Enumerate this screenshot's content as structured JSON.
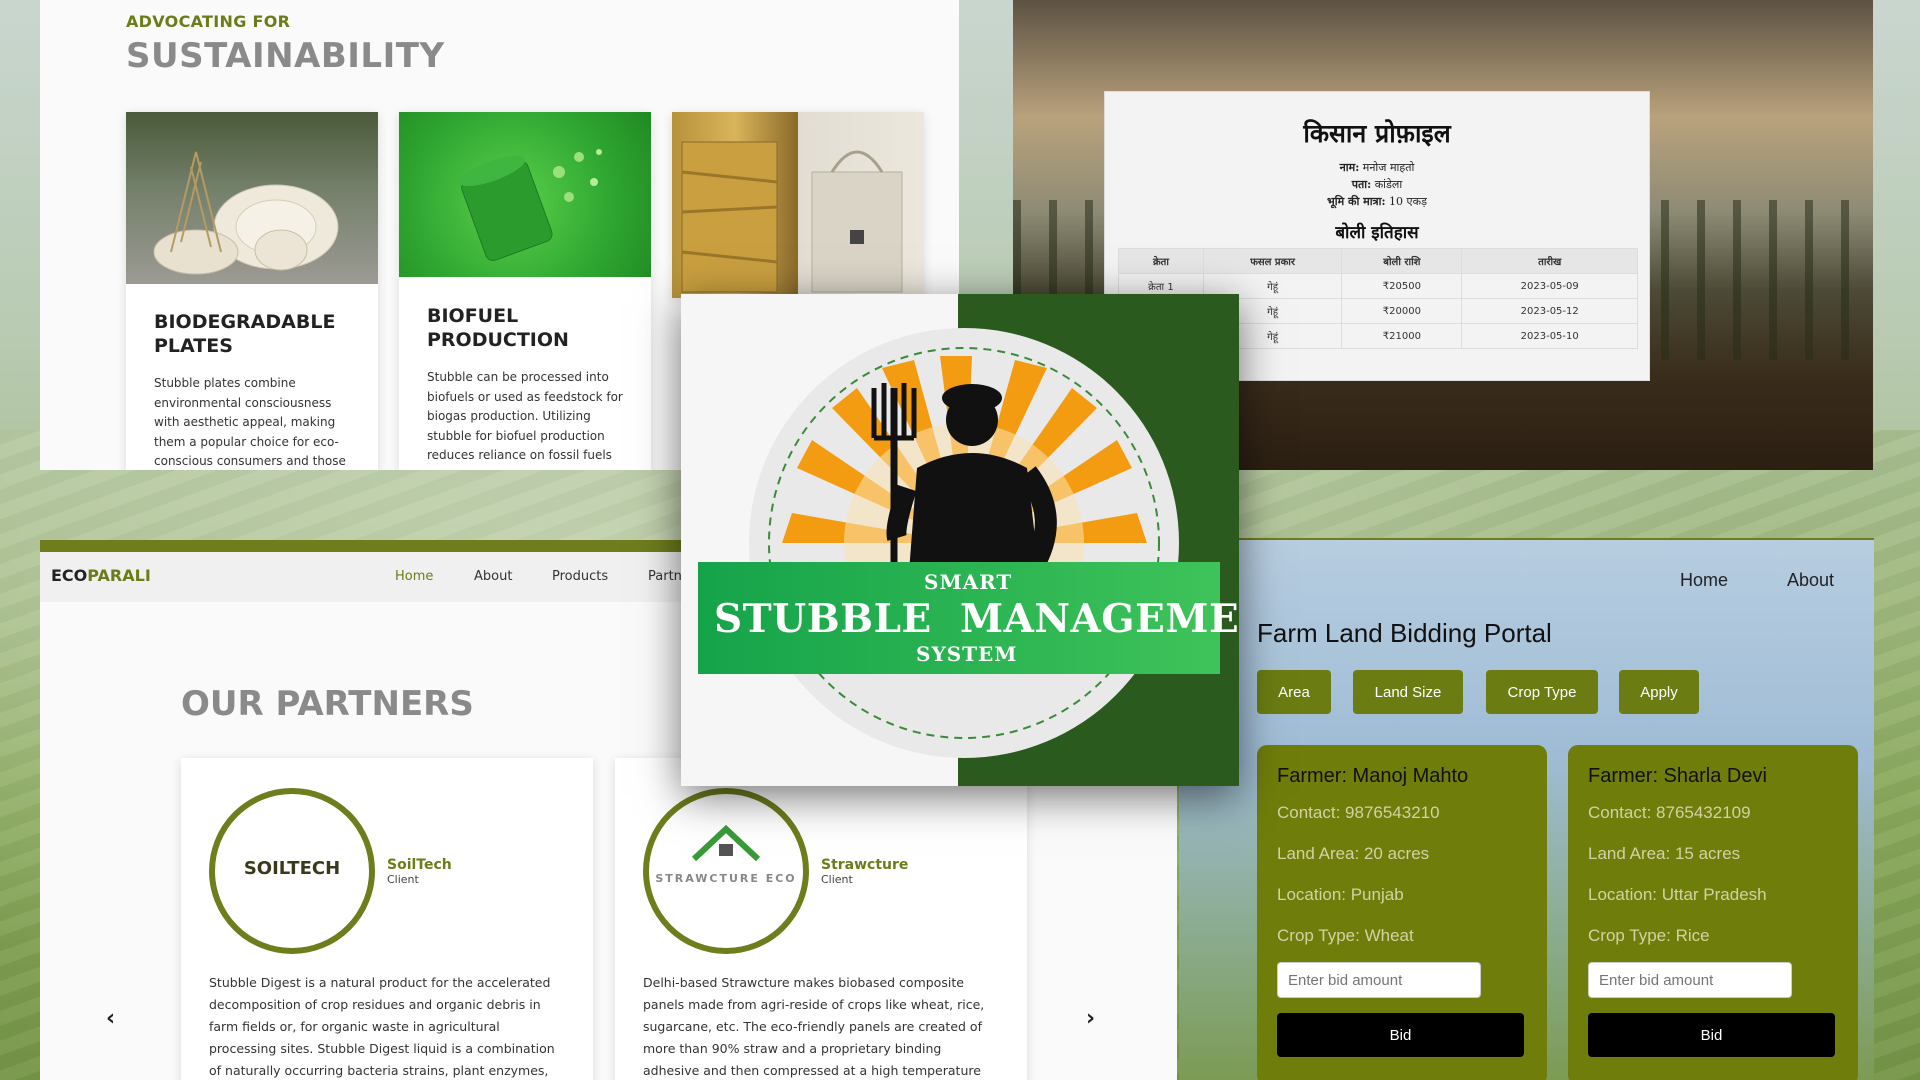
{
  "sustainability": {
    "kicker": "ADVOCATING FOR",
    "title": "SUSTAINABILITY",
    "cards": [
      {
        "title_line1": "BIODEGRADABLE",
        "title_line2": "PLATES",
        "text": "Stubble plates combine environmental consciousness with aesthetic appeal, making them a popular choice for eco-conscious consumers and those"
      },
      {
        "title_line1": "BIOFUEL",
        "title_line2": "PRODUCTION",
        "text": "Stubble can be processed into biofuels or used as feedstock for biogas production. Utilizing stubble for biofuel production reduces reliance on fossil fuels"
      }
    ]
  },
  "farmer_profile": {
    "title": "किसान प्रोफ़ाइल",
    "name_label": "नाम:",
    "name": "मनोज माहतो",
    "address_label": "पता:",
    "address": "कांडेला",
    "land_label": "भूमि की मात्रा:",
    "land": "10 एकड़",
    "history_title": "बोली इतिहास",
    "columns": [
      "क्रेता",
      "फसल प्रकार",
      "बोली राशि",
      "तारीख"
    ],
    "rows": [
      [
        "क्रेता 1",
        "गेहूं",
        "₹20500",
        "2023-05-09"
      ],
      [
        "",
        "गेहूं",
        "₹20000",
        "2023-05-12"
      ],
      [
        "",
        "गेहूं",
        "₹21000",
        "2023-05-10"
      ]
    ]
  },
  "partners": {
    "brand_a": "ECO",
    "brand_b": "PARALI",
    "nav": [
      "Home",
      "About",
      "Products",
      "Partn"
    ],
    "title": "OUR PARTNERS",
    "cards": [
      {
        "logo_text": "SOILTECH",
        "name": "SoilTech",
        "role": "Client",
        "text": "Stubble Digest is a natural product for the accelerated decomposition of crop residues and organic debris in farm fields or, for organic waste in agricultural processing sites. Stubble Digest liquid is a combination of naturally occurring bacteria strains, plant enzymes,"
      },
      {
        "logo_text": "STRAWCTURE ECO",
        "name": "Strawcture",
        "role": "Client",
        "text": "Delhi-based Strawcture makes biobased composite panels made from agri-reside of crops like wheat, rice, sugarcane, etc. The eco-friendly panels are created of more than 90% straw and a proprietary binding adhesive and then compressed at a high temperature"
      }
    ],
    "prev": "‹",
    "next": "›"
  },
  "logo": {
    "smart": "SMART",
    "stubble": "STUBBLE",
    "management": "MANAGEMENT",
    "system": "SYSTEM"
  },
  "bidding": {
    "nav": [
      "Home",
      "About"
    ],
    "title": "Farm Land Bidding Portal",
    "filters": [
      "Area",
      "Land Size",
      "Crop Type",
      "Apply"
    ],
    "farmers": [
      {
        "name": "Farmer: Manoj Mahto",
        "contact": "Contact: 9876543210",
        "area": "Land Area: 20 acres",
        "location": "Location: Punjab",
        "crop": "Crop Type: Wheat",
        "placeholder": "Enter bid amount",
        "button": "Bid"
      },
      {
        "name": "Farmer: Sharla Devi",
        "contact": "Contact: 8765432109",
        "area": "Land Area: 15 acres",
        "location": "Location: Uttar Pradesh",
        "crop": "Crop Type: Rice",
        "placeholder": "Enter bid amount",
        "button": "Bid"
      }
    ]
  },
  "colors": {
    "brand_green": "#6a7d18",
    "logo_dark_green": "#2a5a1e",
    "banner_green": "#15a34a",
    "sun_orange": "#f39c12"
  }
}
